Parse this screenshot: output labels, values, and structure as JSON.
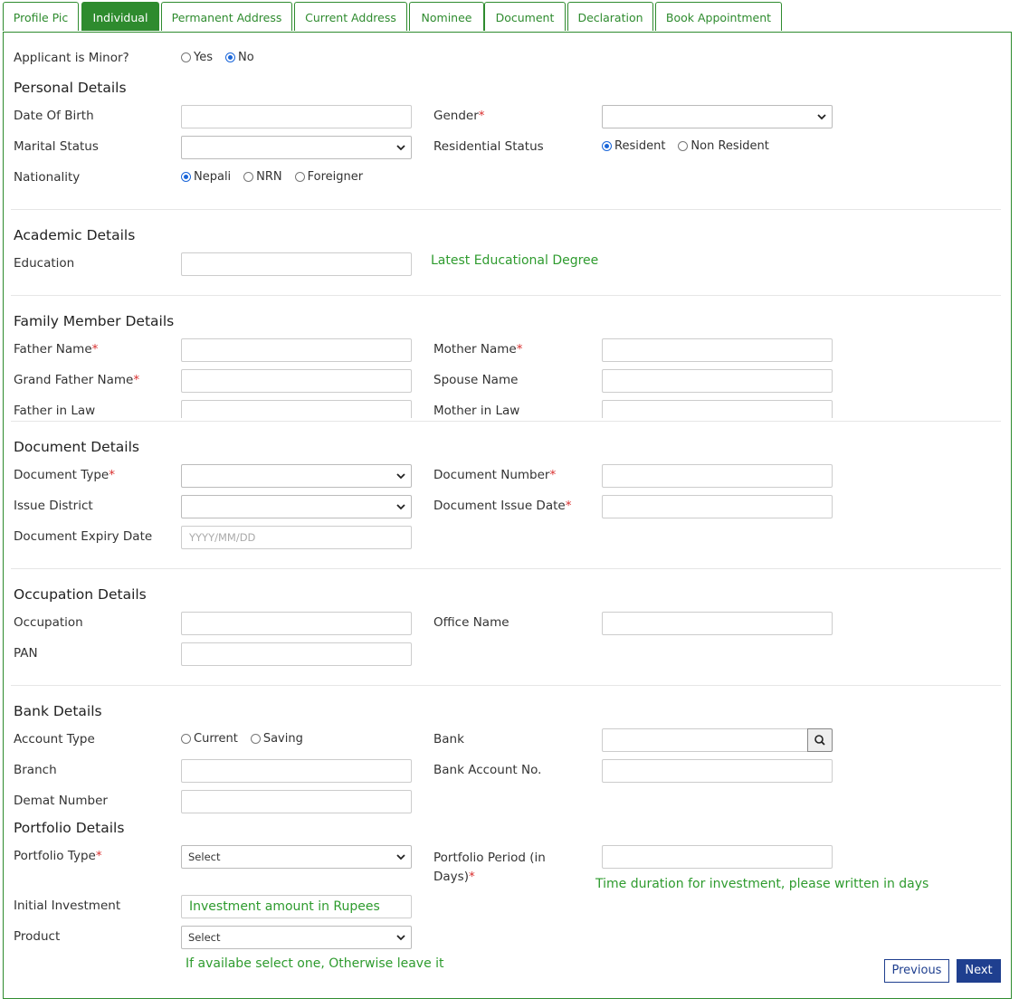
{
  "tabs": [
    {
      "label": "Profile Pic"
    },
    {
      "label": "Individual"
    },
    {
      "label": "Permanent Address"
    },
    {
      "label": "Current Address"
    },
    {
      "label": "Nominee"
    },
    {
      "label": "Document"
    },
    {
      "label": "Declaration"
    },
    {
      "label": "Book Appointment"
    }
  ],
  "minor": {
    "label": "Applicant is Minor?",
    "yes": "Yes",
    "no": "No",
    "selected": "No"
  },
  "personal": {
    "title": "Personal Details",
    "dob": "Date Of Birth",
    "gender": "Gender",
    "marital": "Marital Status",
    "residential": "Residential Status",
    "resident": "Resident",
    "non_resident": "Non Resident",
    "nationality": "Nationality",
    "nepali": "Nepali",
    "nrn": "NRN",
    "foreigner": "Foreigner"
  },
  "academic": {
    "title": "Academic Details",
    "education": "Education",
    "hint": "Latest Educational Degree"
  },
  "family": {
    "title": "Family Member Details",
    "father": "Father Name",
    "mother": "Mother Name",
    "grandfather": "Grand Father Name",
    "spouse": "Spouse Name",
    "father_in_law": "Father in Law",
    "mother_in_law": "Mother in Law"
  },
  "document": {
    "title": "Document Details",
    "type": "Document Type",
    "number": "Document Number",
    "district": "Issue District",
    "issue_date": "Document Issue Date",
    "expiry": "Document Expiry Date",
    "expiry_placeholder": "YYYY/MM/DD"
  },
  "occupation": {
    "title": "Occupation Details",
    "occupation": "Occupation",
    "office": "Office Name",
    "pan": "PAN"
  },
  "bank": {
    "title": "Bank Details",
    "account_type": "Account Type",
    "current": "Current",
    "saving": "Saving",
    "bank": "Bank",
    "branch": "Branch",
    "account_no": "Bank Account No.",
    "demat": "Demat Number"
  },
  "portfolio": {
    "title": "Portfolio Details",
    "type": "Portfolio Type",
    "type_value": "Select",
    "period_line1": "Portfolio Period (in",
    "period_line2": "Days)",
    "period_hint": "Time duration for investment, please written in days",
    "initial": "Initial Investment",
    "initial_placeholder": "Investment amount in Rupees",
    "product": "Product",
    "product_value": "Select",
    "product_hint": "If availabe select one, Otherwise leave it"
  },
  "buttons": {
    "previous": "Previous",
    "next": "Next"
  },
  "colors": {
    "accent": "#2e8b2e",
    "required": "#d9302f",
    "button": "#1f3f8f",
    "radio": "#1a66d9"
  }
}
